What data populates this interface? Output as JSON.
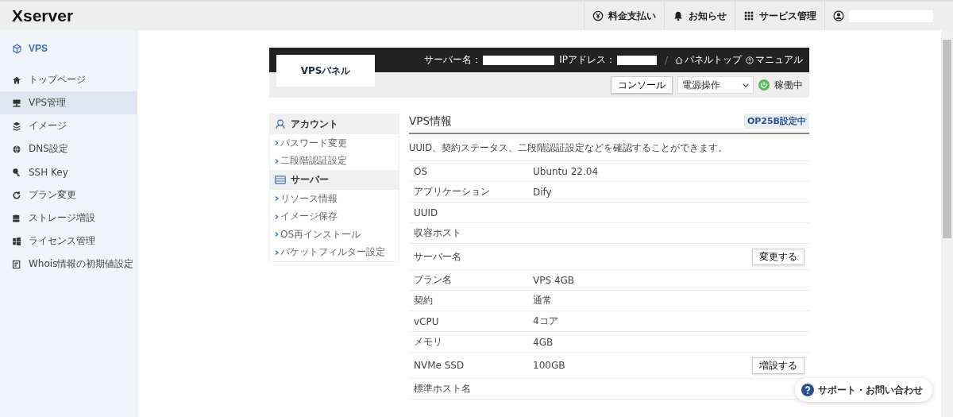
{
  "header": {
    "logo": "Xserver",
    "menu": [
      {
        "label": "料金支払い"
      },
      {
        "label": "お知らせ"
      },
      {
        "label": "サービス管理"
      }
    ]
  },
  "sidebar": {
    "title": "VPS",
    "items": [
      {
        "label": "トップページ",
        "selected": false
      },
      {
        "label": "VPS管理",
        "selected": true
      },
      {
        "label": "イメージ",
        "selected": false
      },
      {
        "label": "DNS設定",
        "selected": false
      },
      {
        "label": "SSH Key",
        "selected": false
      },
      {
        "label": "プラン変更",
        "selected": false
      },
      {
        "label": "ストレージ増設",
        "selected": false
      },
      {
        "label": "ライセンス管理",
        "selected": false
      },
      {
        "label": "Whois情報の初期値設定",
        "selected": false
      }
    ]
  },
  "panel": {
    "title": "VPSパネル",
    "server_label": "サーバー名：",
    "ip_label": "IPアドレス：",
    "separator": "/",
    "links": [
      "パネルトップ",
      "マニュアル"
    ],
    "console_button": "コンソール",
    "power_select": "電源操作",
    "status": "稼働中"
  },
  "menu_groups": [
    {
      "title": "アカウント",
      "items": [
        "パスワード変更",
        "二段階認証設定"
      ]
    },
    {
      "title": "サーバー",
      "items": [
        "リソース情報",
        "イメージ保存",
        "OS再インストール",
        "パケットフィルター設定"
      ]
    }
  ],
  "info": {
    "title": "VPS情報",
    "badge": "OP25B設定中",
    "description": "UUID、契約ステータス、二段階認証設定などを確認することができます。",
    "rows": [
      {
        "label": "OS",
        "value": "Ubuntu 22.04"
      },
      {
        "label": "アプリケーション",
        "value": "Dify"
      },
      {
        "label": "UUID"
      },
      {
        "label": "収容ホスト"
      },
      {
        "label": "サーバー名",
        "button": "変更する"
      },
      {
        "label": "プラン名",
        "value": "VPS 4GB"
      },
      {
        "label": "契約",
        "value": "通常"
      },
      {
        "label": "vCPU",
        "value": "4コア"
      },
      {
        "label": "メモリ",
        "value": "4GB"
      },
      {
        "label": "NVMe SSD",
        "value": "100GB",
        "button": "増設する"
      },
      {
        "label": "標準ホスト名"
      }
    ]
  },
  "support_button": "サポート・お問い合わせ"
}
